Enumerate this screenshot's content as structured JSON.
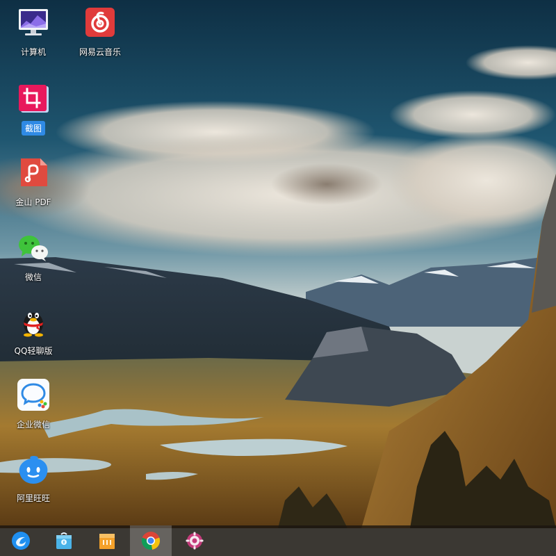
{
  "desktop": {
    "icons": [
      {
        "id": "computer",
        "label": "计算机",
        "icon": "computer-icon"
      },
      {
        "id": "netease-music",
        "label": "网易云音乐",
        "icon": "netease-music-icon",
        "color": "#e03b3b"
      },
      {
        "id": "screenshot",
        "label": "截图",
        "icon": "screenshot-icon",
        "color": "#e8195c",
        "selected": true
      },
      {
        "id": "kingsoft-pdf",
        "label": "金山 PDF",
        "icon": "pdf-icon",
        "color": "#e04a3f"
      },
      {
        "id": "wechat",
        "label": "微信",
        "icon": "wechat-icon",
        "color": "#3fc33b"
      },
      {
        "id": "qq",
        "label": "QQ轻聊版",
        "icon": "qq-penguin-icon"
      },
      {
        "id": "wecom",
        "label": "企业微信",
        "icon": "wecom-icon",
        "color": "#2f8ae5"
      },
      {
        "id": "aliwangwang",
        "label": "阿里旺旺",
        "icon": "aliwangwang-icon",
        "color": "#2b8ff0"
      }
    ]
  },
  "taskbar": {
    "items": [
      {
        "id": "launcher",
        "icon": "launcher-icon"
      },
      {
        "id": "app-store",
        "icon": "app-store-icon"
      },
      {
        "id": "file-manager",
        "icon": "file-manager-icon"
      },
      {
        "id": "chrome",
        "icon": "chrome-icon",
        "active": true
      },
      {
        "id": "settings",
        "icon": "settings-icon"
      }
    ]
  },
  "colors": {
    "selection": "#2f8ae5",
    "taskbar_bg": "#1c1610"
  }
}
